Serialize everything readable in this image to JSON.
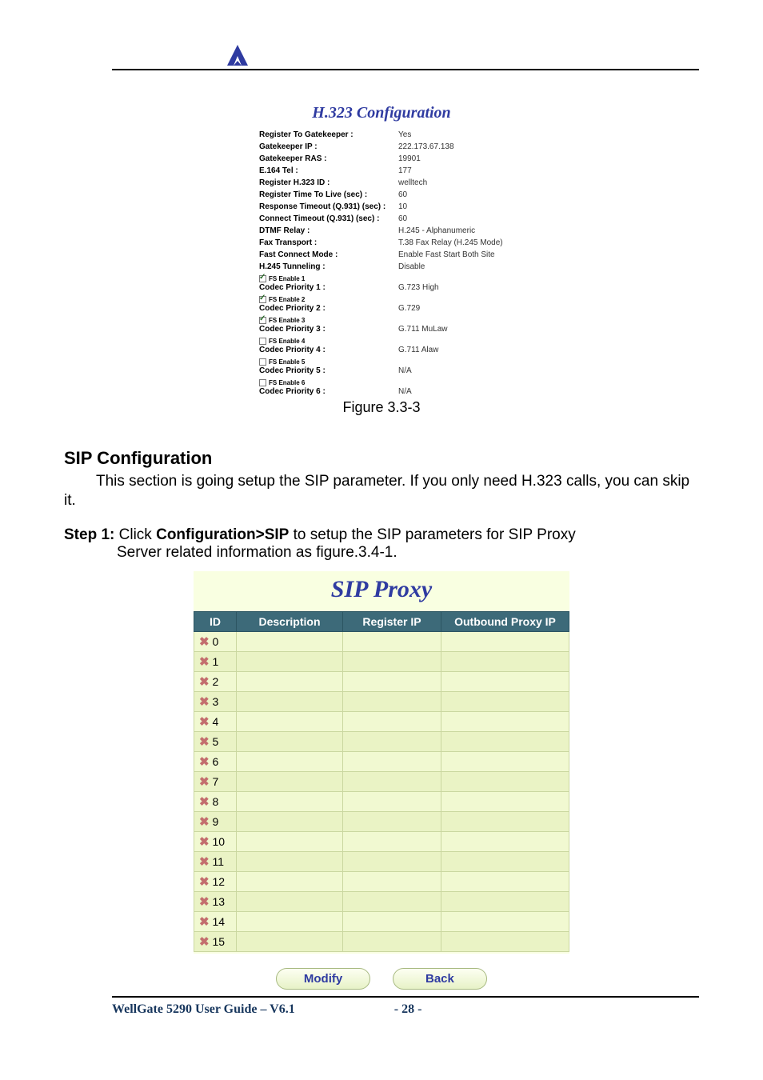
{
  "header": {
    "logo_alt": "logo"
  },
  "h323": {
    "title": "H.323 Configuration",
    "rows": [
      {
        "label": "Register To Gatekeeper :",
        "value": "Yes"
      },
      {
        "label": "Gatekeeper IP :",
        "value": "222.173.67.138"
      },
      {
        "label": "Gatekeeper RAS :",
        "value": "19901"
      },
      {
        "label": "E.164 Tel :",
        "value": "177"
      },
      {
        "label": "Register H.323 ID :",
        "value": "welltech"
      },
      {
        "label": "Register Time To Live (sec) :",
        "value": "60"
      },
      {
        "label": "Response Timeout (Q.931) (sec) :",
        "value": "10"
      },
      {
        "label": "Connect Timeout (Q.931) (sec) :",
        "value": "60"
      },
      {
        "label": "DTMF Relay :",
        "value": "H.245 - Alphanumeric"
      },
      {
        "label": "Fax Transport :",
        "value": "T.38 Fax Relay (H.245 Mode)"
      },
      {
        "label": "Fast Connect Mode :",
        "value": "Enable Fast Start Both Site"
      },
      {
        "label": "H.245 Tunneling :",
        "value": "Disable"
      }
    ],
    "codecs": [
      {
        "checked": true,
        "fs": "FS Enable 1",
        "label": "Codec Priority 1 :",
        "value": "G.723 High"
      },
      {
        "checked": true,
        "fs": "FS Enable 2",
        "label": "Codec Priority 2 :",
        "value": "G.729"
      },
      {
        "checked": true,
        "fs": "FS Enable 3",
        "label": "Codec Priority 3 :",
        "value": "G.711 MuLaw"
      },
      {
        "checked": false,
        "fs": "FS Enable 4",
        "label": "Codec Priority 4 :",
        "value": "G.711 Alaw"
      },
      {
        "checked": false,
        "fs": "FS Enable 5",
        "label": "Codec Priority 5 :",
        "value": "N/A"
      },
      {
        "checked": false,
        "fs": "FS Enable 6",
        "label": "Codec Priority 6 :",
        "value": "N/A"
      }
    ],
    "figure_caption": "Figure 3.3-3"
  },
  "sip": {
    "heading": "SIP Configuration",
    "intro": "This section is going setup the SIP parameter. If you only need H.323 calls, you can skip it.",
    "step_label": "Step 1:",
    "step_pre": " Click ",
    "step_path": "Configuration>SIP",
    "step_post": " to setup the SIP parameters for SIP Proxy",
    "step_cont": "Server related information as figure.3.4-1.",
    "table_title": "SIP Proxy",
    "headers": {
      "id": "ID",
      "desc": "Description",
      "reg": "Register IP",
      "out": "Outbound Proxy IP"
    },
    "rows": [
      {
        "id": "0",
        "desc": "",
        "reg": "",
        "out": ""
      },
      {
        "id": "1",
        "desc": "",
        "reg": "",
        "out": ""
      },
      {
        "id": "2",
        "desc": "",
        "reg": "",
        "out": ""
      },
      {
        "id": "3",
        "desc": "",
        "reg": "",
        "out": ""
      },
      {
        "id": "4",
        "desc": "",
        "reg": "",
        "out": ""
      },
      {
        "id": "5",
        "desc": "",
        "reg": "",
        "out": ""
      },
      {
        "id": "6",
        "desc": "",
        "reg": "",
        "out": ""
      },
      {
        "id": "7",
        "desc": "",
        "reg": "",
        "out": ""
      },
      {
        "id": "8",
        "desc": "",
        "reg": "",
        "out": ""
      },
      {
        "id": "9",
        "desc": "",
        "reg": "",
        "out": ""
      },
      {
        "id": "10",
        "desc": "",
        "reg": "",
        "out": ""
      },
      {
        "id": "11",
        "desc": "",
        "reg": "",
        "out": ""
      },
      {
        "id": "12",
        "desc": "",
        "reg": "",
        "out": ""
      },
      {
        "id": "13",
        "desc": "",
        "reg": "",
        "out": ""
      },
      {
        "id": "14",
        "desc": "",
        "reg": "",
        "out": ""
      },
      {
        "id": "15",
        "desc": "",
        "reg": "",
        "out": ""
      }
    ],
    "modify_label": "Modify",
    "back_label": "Back"
  },
  "footer": {
    "title": "WellGate 5290 User Guide – V6.1",
    "page": "- 28 -"
  }
}
